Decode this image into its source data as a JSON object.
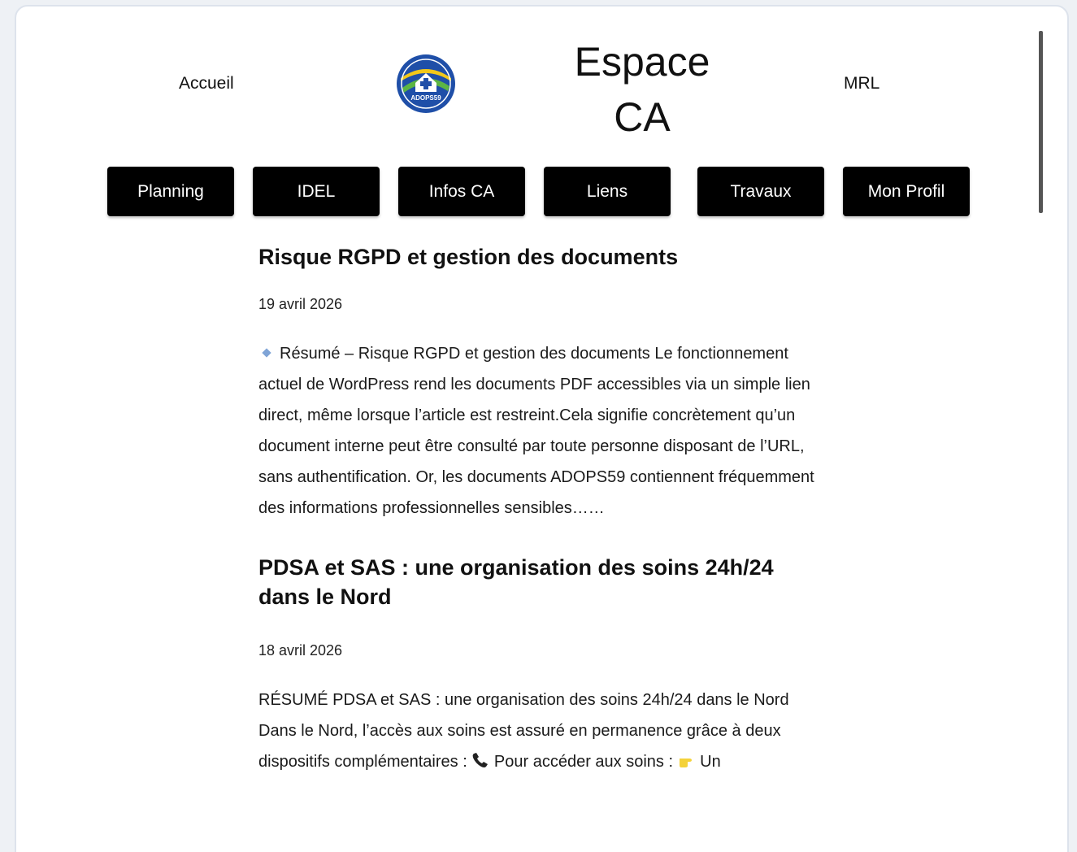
{
  "header": {
    "nav_left": "Accueil",
    "nav_right": "MRL",
    "logo_text": "ADOPS59",
    "site_title_line1": "Espace",
    "site_title_line2": "CA"
  },
  "menu": [
    {
      "label": "Planning"
    },
    {
      "label": "IDEL"
    },
    {
      "label": "Infos CA"
    },
    {
      "label": "Liens"
    },
    {
      "label": "Travaux"
    },
    {
      "label": "Mon Profil"
    }
  ],
  "posts": [
    {
      "title": "Risque RGPD et gestion des documents",
      "date": "19 avril 2026",
      "excerpt": "Résumé – Risque RGPD et gestion des documents Le fonctionnement actuel de WordPress rend les documents PDF accessibles via un simple lien direct, même lorsque l’article est restreint.Cela signifie concrètement qu’un document interne peut être consulté par toute personne disposant de l’URL, sans authentification. Or, les documents ADOPS59 contiennent fréquemment des informations professionnelles sensibles……"
    },
    {
      "title": "PDSA et SAS : une organisation des soins 24h/24 dans le Nord",
      "date": "18 avril 2026",
      "excerpt_part1": "RÉSUMÉ PDSA et SAS : une organisation des soins 24h/24 dans le Nord Dans le Nord, l’accès aux soins est assuré en permanence grâce à deux dispositifs complémentaires :",
      "excerpt_part2": "Pour accéder aux soins :",
      "excerpt_part3": "Un"
    }
  ],
  "colors": {
    "menu_bg": "#000000",
    "menu_text": "#ffffff",
    "page_bg": "#ffffff",
    "logo_blue": "#1f4fa8",
    "logo_green": "#5cb544",
    "logo_yellow": "#f2c81a"
  },
  "icons": {
    "excerpt_bullet": "small-blue-diamond-icon",
    "phone": "telephone-receiver-icon",
    "hand": "pointing-hand-icon"
  }
}
